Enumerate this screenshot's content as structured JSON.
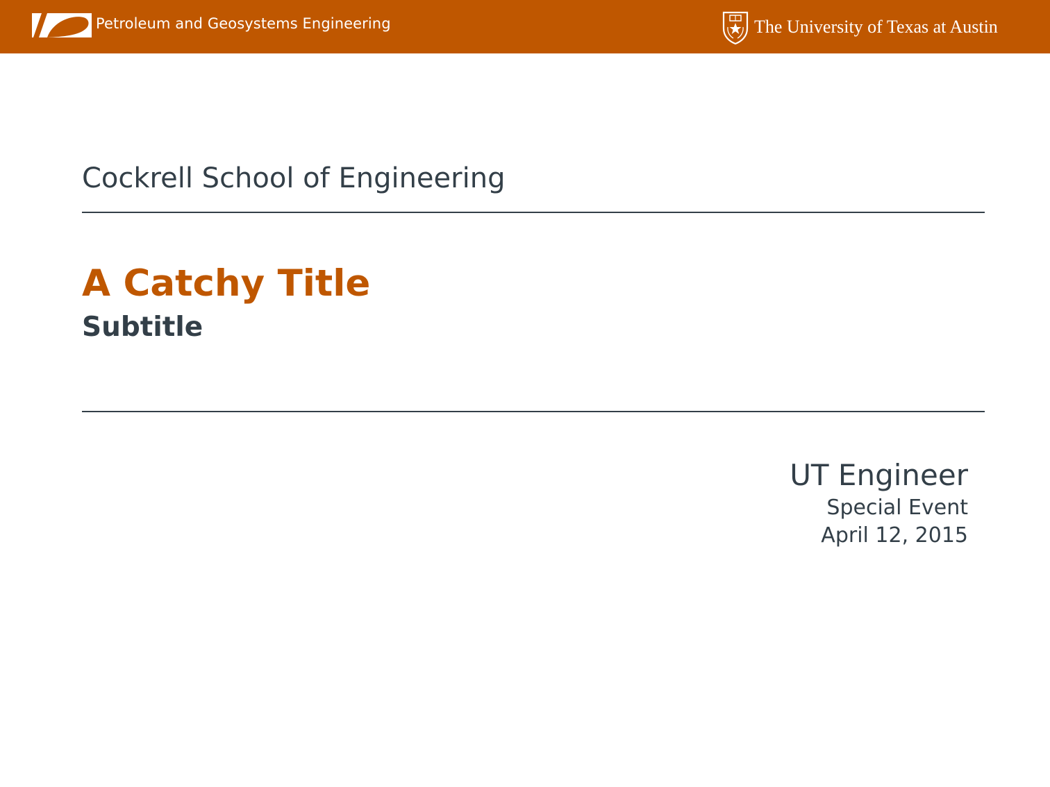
{
  "header": {
    "department": "Petroleum and Geosystems Engineering",
    "university": "The University of Texas at Austin",
    "background_color": "#bf5700",
    "logo_icon": "pge-logo-icon",
    "seal_icon": "ut-seal-icon"
  },
  "slide": {
    "school": "Cockrell School of Engineering",
    "title": "A Catchy Title",
    "subtitle": "Subtitle",
    "author": "UT Engineer",
    "event": "Special Event",
    "date": "April 12, 2015",
    "accent_color": "#bf5700",
    "text_color": "#333f48"
  }
}
